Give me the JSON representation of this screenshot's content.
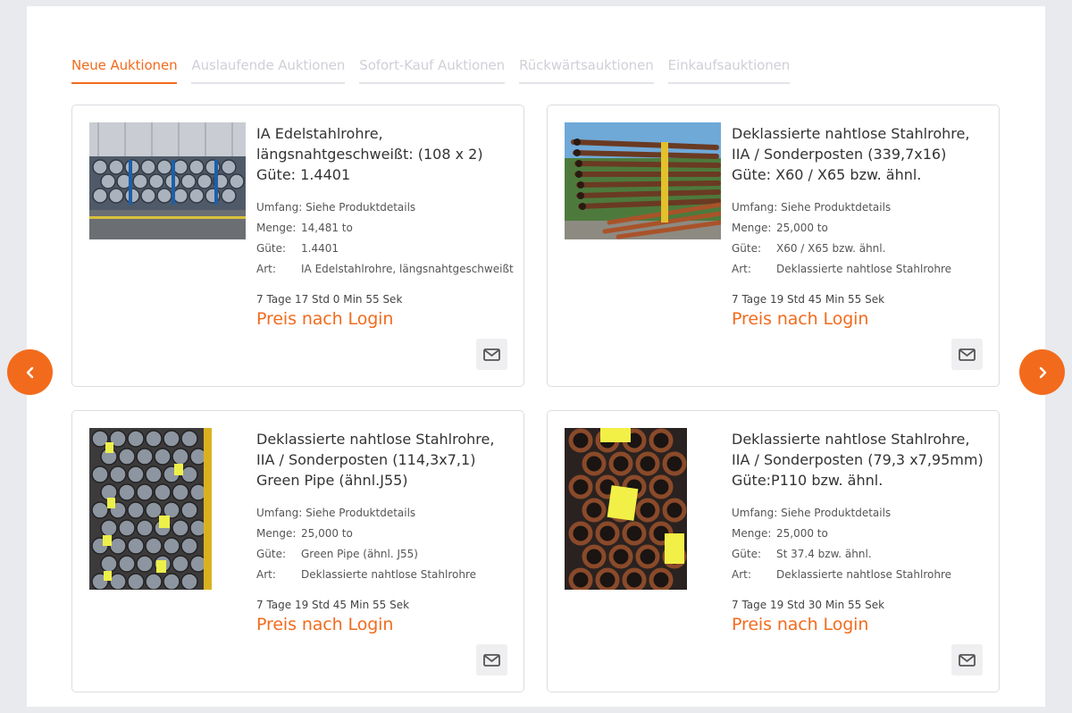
{
  "tabs": [
    {
      "label": "Neue Auktionen"
    },
    {
      "label": "Auslaufende Auktionen"
    },
    {
      "label": "Sofort-Kauf Auktionen"
    },
    {
      "label": "Rückwärtsauktionen"
    },
    {
      "label": "Einkaufsauktionen"
    }
  ],
  "active_tab": "Neue Auktionen",
  "colors": {
    "accent": "#f26b1d",
    "background": "#e9eaee",
    "panel": "#ffffff"
  },
  "spec_labels": {
    "umfang": "Umfang:",
    "menge": "Menge:",
    "guete": "Güte:",
    "art": "Art:"
  },
  "cards": [
    {
      "title": "IA Edelstahlrohre, längsnahtgeschweißt: (108 x 2) Güte: 1.4401",
      "umfang": "Siehe Produktdetails",
      "menge": "14,481 to",
      "guete": "1.4401",
      "art": "IA Edelstahlrohre, längsnahtgeschweißt",
      "timer": "7 Tage 17 Std 0 Min 55 Sek",
      "price": "Preis nach Login"
    },
    {
      "title": "Deklassierte nahtlose Stahlrohre, IIA / Sonderposten (339,7x16) Güte: X60 / X65 bzw. ähnl.",
      "umfang": "Siehe Produktdetails",
      "menge": "25,000 to",
      "guete": "X60 / X65 bzw. ähnl.",
      "art": "Deklassierte nahtlose Stahlrohre",
      "timer": "7 Tage 19 Std 45 Min 55 Sek",
      "price": "Preis nach Login"
    },
    {
      "title": "Deklassierte nahtlose Stahlrohre, IIA / Sonderposten (114,3x7,1) Green Pipe (ähnl.J55)",
      "umfang": "Siehe Produktdetails",
      "menge": "25,000 to",
      "guete": "Green Pipe (ähnl. J55)",
      "art": "Deklassierte nahtlose Stahlrohre",
      "timer": "7 Tage 19 Std 45 Min 55 Sek",
      "price": "Preis nach Login"
    },
    {
      "title": "Deklassierte nahtlose Stahlrohre, IIA / Sonderposten (79,3 x7,95mm) Güte:P110 bzw. ähnl.",
      "umfang": "Siehe Produktdetails",
      "menge": "25,000 to",
      "guete": "St 37.4 bzw. ähnl.",
      "art": "Deklassierte nahtlose Stahlrohre",
      "timer": "7 Tage 19 Std 30 Min 55 Sek",
      "price": "Preis nach Login"
    }
  ],
  "icons": {
    "mail": "envelope-icon",
    "prev": "chevron-left-icon",
    "next": "chevron-right-icon"
  }
}
